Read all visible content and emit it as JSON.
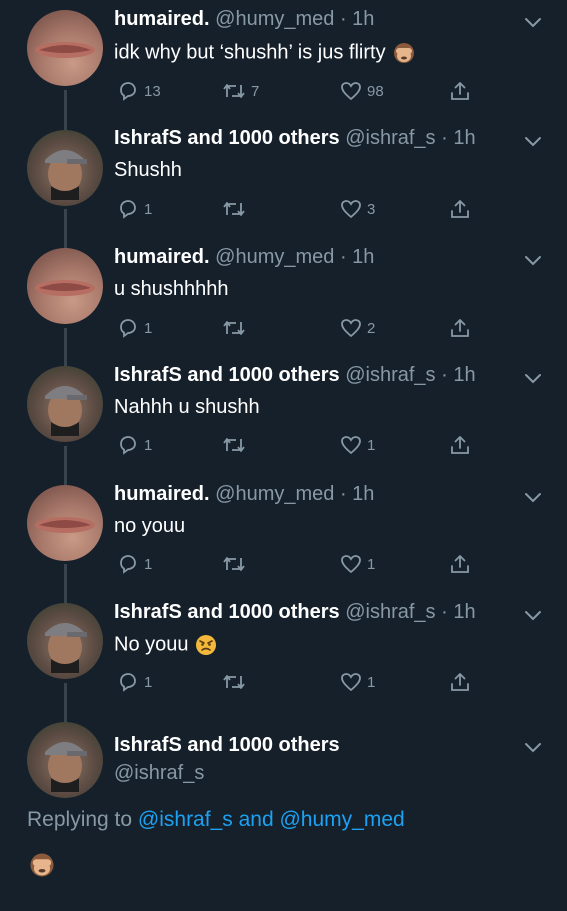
{
  "tweets": [
    {
      "name": "humaired.",
      "handle": "@humy_med",
      "sep": " · ",
      "time": "1h",
      "text": "idk why but ‘shushh’ is jus flirty",
      "emoji": "see-no-evil-monkey",
      "replies": "13",
      "retweets": "7",
      "likes": "98",
      "avatar": "her"
    },
    {
      "name": "IshrafS and 1000 others",
      "handle": "@ishraf_s",
      "sep": " · ",
      "time": "1h",
      "text": "Shushh",
      "replies": "1",
      "retweets": "",
      "likes": "3",
      "avatar": "him"
    },
    {
      "name": "humaired.",
      "handle": "@humy_med",
      "sep": " · ",
      "time": "1h",
      "text": "u shushhhhh",
      "replies": "1",
      "retweets": "",
      "likes": "2",
      "avatar": "her"
    },
    {
      "name": "IshrafS and 1000 others",
      "handle": "@ishraf_s",
      "sep": " · ",
      "time": "1h",
      "text": "Nahhh u shushh",
      "replies": "1",
      "retweets": "",
      "likes": "1",
      "avatar": "him"
    },
    {
      "name": "humaired.",
      "handle": "@humy_med",
      "sep": " · ",
      "time": "1h",
      "text": "no youu",
      "replies": "1",
      "retweets": "",
      "likes": "1",
      "avatar": "her"
    },
    {
      "name": "IshrafS and 1000 others",
      "handle": "@ishraf_s",
      "sep": " · ",
      "time": "1h",
      "text": "No youu",
      "emoji": "angry-face",
      "replies": "1",
      "retweets": "",
      "likes": "1",
      "avatar": "him"
    }
  ],
  "focused": {
    "name": "IshrafS and 1000 others",
    "handle": "@ishraf_s"
  },
  "replying": {
    "prefix": "Replying to ",
    "mention1": "@ishraf_s",
    "and": " and ",
    "mention2": "@humy_med"
  },
  "compose": {
    "emoji": "see-no-evil-monkey"
  },
  "colors": {
    "background": "#15202b",
    "muted": "#8899a6",
    "link": "#1da1f2",
    "thread_line": "#38444d"
  },
  "icons": {
    "reply": "reply-icon",
    "retweet": "retweet-icon",
    "like": "heart-icon",
    "share": "share-icon",
    "menu": "chevron-down-icon"
  }
}
